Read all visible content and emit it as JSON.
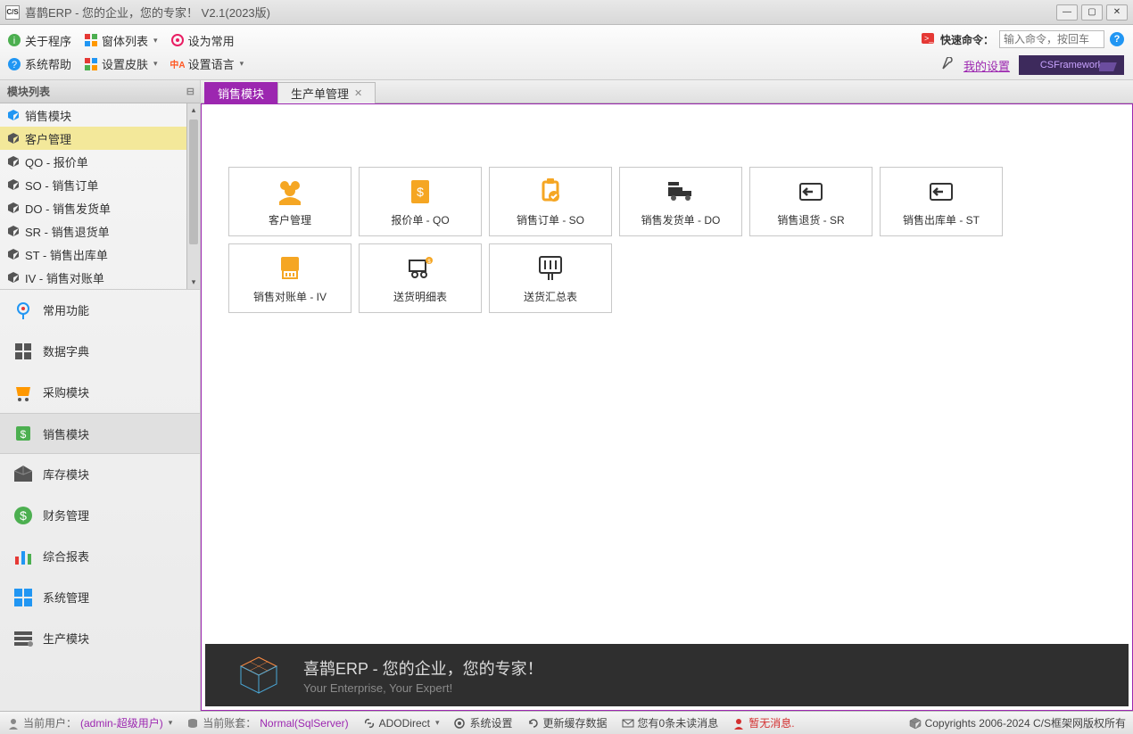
{
  "window": {
    "title": "喜鹊ERP - 您的企业，您的专家！ V2.1(2023版)",
    "app_icon_text": "C/S"
  },
  "toolbar": {
    "row1": {
      "about": "关于程序",
      "windows": "窗体列表",
      "set_default": "设为常用"
    },
    "row2": {
      "help": "系统帮助",
      "skin": "设置皮肤",
      "language": "设置语言"
    },
    "quick_cmd_label": "快速命令：",
    "quick_cmd_placeholder": "输入命令，按回车",
    "my_settings": "我的设置",
    "csframework": "CSFramework"
  },
  "sidebar": {
    "header": "模块列表",
    "tree": [
      {
        "label": "销售模块",
        "selected": false,
        "root": true
      },
      {
        "label": "客户管理",
        "selected": true
      },
      {
        "label": "QO - 报价单",
        "selected": false
      },
      {
        "label": "SO - 销售订单",
        "selected": false
      },
      {
        "label": "DO - 销售发货单",
        "selected": false
      },
      {
        "label": "SR - 销售退货单",
        "selected": false
      },
      {
        "label": "ST - 销售出库单",
        "selected": false
      },
      {
        "label": "IV - 销售对账单",
        "selected": false
      }
    ],
    "modules": [
      {
        "label": "常用功能",
        "icon": "pin"
      },
      {
        "label": "数据字典",
        "icon": "dict"
      },
      {
        "label": "采购模块",
        "icon": "cart"
      },
      {
        "label": "销售模块",
        "icon": "sales",
        "active": true
      },
      {
        "label": "库存模块",
        "icon": "inventory"
      },
      {
        "label": "财务管理",
        "icon": "finance"
      },
      {
        "label": "综合报表",
        "icon": "report"
      },
      {
        "label": "系统管理",
        "icon": "system"
      },
      {
        "label": "生产模块",
        "icon": "production"
      }
    ]
  },
  "tabs": [
    {
      "label": "销售模块",
      "active": true,
      "closable": false
    },
    {
      "label": "生产单管理",
      "active": false,
      "closable": true
    }
  ],
  "tiles": [
    {
      "label": "客户管理",
      "icon": "users",
      "color": "#f5a623"
    },
    {
      "label": "报价单 - QO",
      "icon": "quote",
      "color": "#f5a623"
    },
    {
      "label": "销售订单 - SO",
      "icon": "order",
      "color": "#f5a623"
    },
    {
      "label": "销售发货单 - DO",
      "icon": "truck",
      "color": "#333"
    },
    {
      "label": "销售退货 - SR",
      "icon": "return",
      "color": "#333"
    },
    {
      "label": "销售出库单 - ST",
      "icon": "outbound",
      "color": "#333"
    },
    {
      "label": "销售对账单 - IV",
      "icon": "invoice",
      "color": "#f5a623"
    },
    {
      "label": "送货明细表",
      "icon": "delivery",
      "color": "#333"
    },
    {
      "label": "送货汇总表",
      "icon": "summary",
      "color": "#333"
    }
  ],
  "banner": {
    "title": "喜鹊ERP - 您的企业，您的专家！",
    "subtitle": "Your Enterprise, Your Expert!"
  },
  "statusbar": {
    "user_label": "当前用户：",
    "user_value": "(admin-超级用户)",
    "db_label": "当前账套：",
    "db_value": "Normal(SqlServer)",
    "ado": "ADODirect",
    "settings": "系统设置",
    "refresh": "更新缓存数据",
    "unread": "您有0条未读消息",
    "no_msg": "暂无消息.",
    "copyright": "Copyrights 2006-2024 C/S框架网版权所有"
  }
}
